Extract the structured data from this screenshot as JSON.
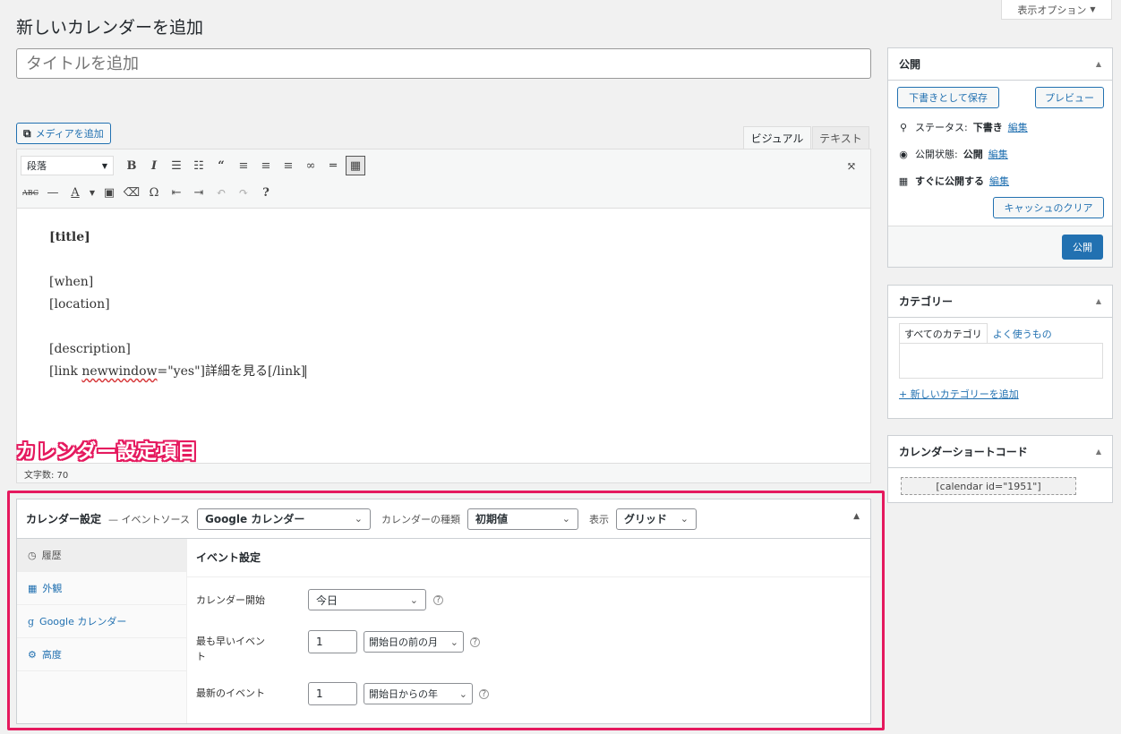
{
  "screen_options": {
    "label": "表示オプション",
    "arrow": "▼"
  },
  "page_title": "新しいカレンダーを追加",
  "title_input": {
    "placeholder": "タイトルを追加"
  },
  "editor": {
    "add_media": "メディアを追加",
    "tabs": {
      "visual": "ビジュアル",
      "text": "テキスト"
    },
    "format_select": "段落",
    "content": {
      "line1": "[title]",
      "line2": "[when]",
      "line3": "[location]",
      "line4": "[description]",
      "line5_a": "[link ",
      "line5_b": "newwindow",
      "line5_c": "=\"yes\"]詳細を見る[/link]"
    },
    "word_count": "文字数: 70"
  },
  "callout": "カレンダー設定項目",
  "calendar_settings": {
    "title": "カレンダー設定",
    "source_label": "— イベントソース",
    "source_value": "Google カレンダー",
    "type_label": "カレンダーの種類",
    "type_value": "初期値",
    "display_label": "表示",
    "display_value": "グリッド",
    "nav": [
      "履歴",
      "外観",
      "Google カレンダー",
      "高度"
    ],
    "panel_title": "イベント設定",
    "fields": {
      "start_label": "カレンダー開始",
      "start_value": "今日",
      "earliest_label_1": "最も早いイベン",
      "earliest_label_2": "ト",
      "earliest_num": "1",
      "earliest_unit": "開始日の前の月",
      "latest_label": "最新のイベント",
      "latest_num": "1",
      "latest_unit": "開始日からの年"
    }
  },
  "publish": {
    "title": "公開",
    "save_draft": "下書きとして保存",
    "preview": "プレビュー",
    "status_label": "ステータス:",
    "status_value": "下書き",
    "visibility_label": "公開状態:",
    "visibility_value": "公開",
    "schedule": "すぐに公開する",
    "edit": "編集",
    "clear_cache": "キャッシュのクリア",
    "publish_button": "公開"
  },
  "categories": {
    "title": "カテゴリー",
    "tab_all": "すべてのカテゴリ",
    "tab_popular": "よく使うもの",
    "add_new": "+ 新しいカテゴリーを追加"
  },
  "shortcode_box": {
    "title": "カレンダーショートコード",
    "code": "[calendar id=\"1951\"]"
  }
}
